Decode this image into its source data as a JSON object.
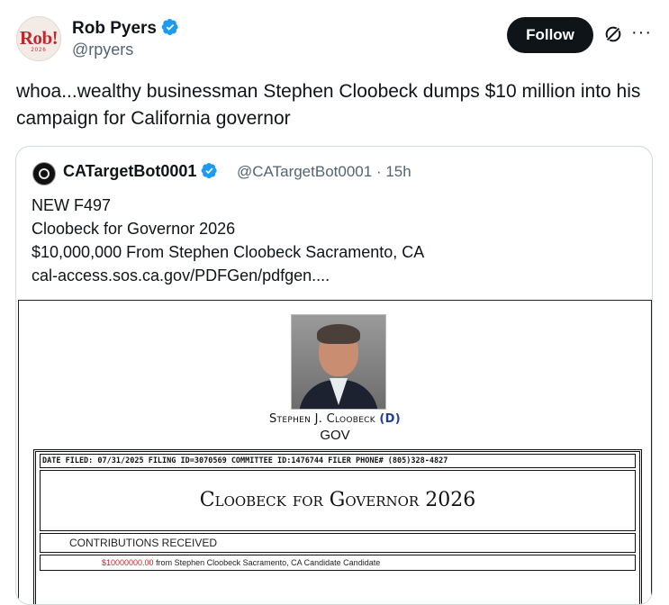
{
  "author": {
    "avatar_text": "Rob!",
    "avatar_subtext": "2026",
    "name": "Rob Pyers",
    "handle": "@rpyers"
  },
  "actions": {
    "follow_label": "Follow",
    "more_label": "···"
  },
  "tweet": {
    "text": "whoa...wealthy businessman Stephen Cloobeck dumps $10 million into his campaign for California governor"
  },
  "quote": {
    "name": "CATargetBot0001",
    "handle": "@CATargetBot0001",
    "time": "15h",
    "lines": [
      "NEW F497",
      "Cloobeck for Governor 2026",
      "$10,000,000 From Stephen Cloobeck Sacramento, CA",
      "cal-access.sos.ca.gov/PDFGen/pdfgen...."
    ]
  },
  "document": {
    "candidate_name": "Stephen J. Cloobeck",
    "party": "(D)",
    "office": "GOV",
    "header_line": "DATE FILED: 07/31/2025 FILING ID=3070569 COMMITTEE ID:1476744 FILER PHONE# (805)328-4827",
    "committee_title": "Cloobeck for Governor 2026",
    "section_label": "CONTRIBUTIONS RECEIVED",
    "entry_amount": "$10000000.00",
    "entry_text": " from Stephen Cloobeck Sacramento, CA Candidate Candidate"
  },
  "colors": {
    "verified_blue": "#1d9bf0",
    "follow_bg": "#0f1419",
    "secondary_text": "#536471",
    "amount_red": "#c0262e",
    "party_blue": "#1f3ea0"
  }
}
